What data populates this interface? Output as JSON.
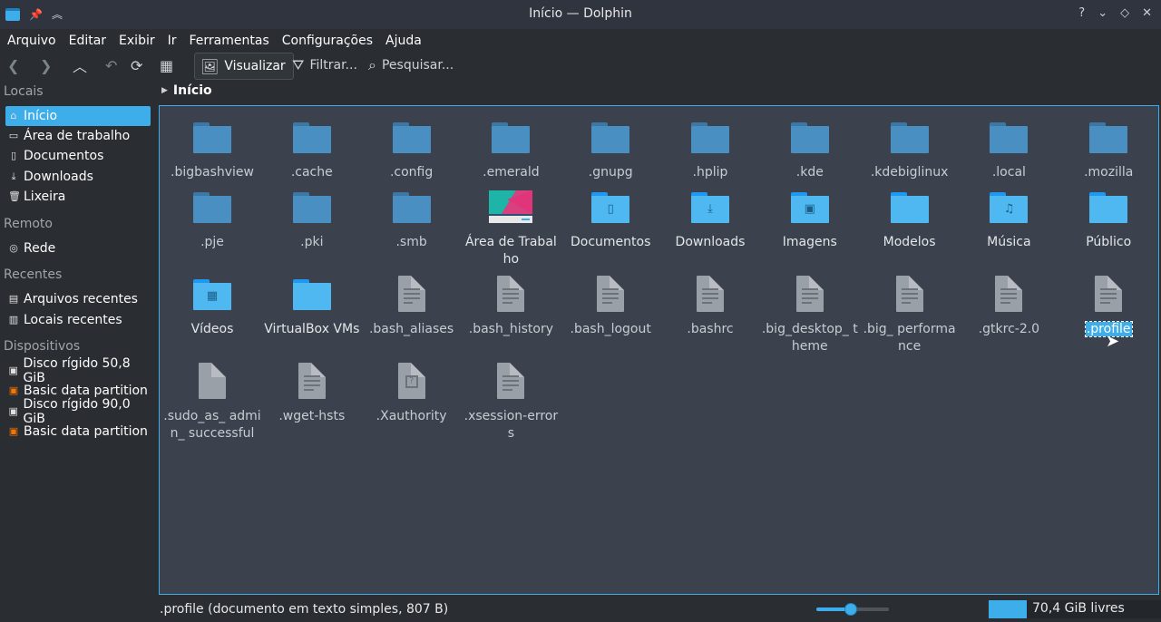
{
  "window": {
    "title": "Início — Dolphin",
    "controls": [
      "?",
      "⌄",
      "◇",
      "✕"
    ]
  },
  "menu": [
    "Arquivo",
    "Editar",
    "Exibir",
    "Ir",
    "Ferramentas",
    "Configurações",
    "Ajuda"
  ],
  "toolbar": {
    "view_label": "Visualizar",
    "filter_label": "Filtrar...",
    "search_label": "Pesquisar..."
  },
  "sidebar": {
    "places_title": "Locais",
    "places": [
      "Início",
      "Área de trabalho",
      "Documentos",
      "Downloads",
      "Lixeira"
    ],
    "remote_title": "Remoto",
    "remote": [
      "Rede"
    ],
    "recent_title": "Recentes",
    "recent": [
      "Arquivos recentes",
      "Locais recentes"
    ],
    "devices_title": "Dispositivos",
    "devices": [
      "Disco rígido 50,8 GiB",
      "Basic data partition",
      "Disco rígido 90,0 GiB",
      "Basic data partition"
    ]
  },
  "breadcrumb": "Início",
  "files": [
    {
      "label": ".bigbashview",
      "kind": "folder-dim"
    },
    {
      "label": ".cache",
      "kind": "folder-dim"
    },
    {
      "label": ".config",
      "kind": "folder-dim"
    },
    {
      "label": ".emerald",
      "kind": "folder-dim"
    },
    {
      "label": ".gnupg",
      "kind": "folder-dim"
    },
    {
      "label": ".hplip",
      "kind": "folder-dim"
    },
    {
      "label": ".kde",
      "kind": "folder-dim"
    },
    {
      "label": ".kdebiglinux",
      "kind": "folder-dim"
    },
    {
      "label": ".local",
      "kind": "folder-dim"
    },
    {
      "label": ".mozilla",
      "kind": "folder-dim"
    },
    {
      "label": ".pje",
      "kind": "folder-dim"
    },
    {
      "label": ".pki",
      "kind": "folder-dim"
    },
    {
      "label": ".smb",
      "kind": "folder-dim"
    },
    {
      "label": "Área de Trabalho",
      "kind": "image"
    },
    {
      "label": "Documentos",
      "kind": "folder-bright",
      "glyph": "▯"
    },
    {
      "label": "Downloads",
      "kind": "folder-bright",
      "glyph": "⤓"
    },
    {
      "label": "Imagens",
      "kind": "folder-bright",
      "glyph": "▣"
    },
    {
      "label": "Modelos",
      "kind": "folder-bright",
      "glyph": ""
    },
    {
      "label": "Música",
      "kind": "folder-bright",
      "glyph": "♫"
    },
    {
      "label": "Público",
      "kind": "folder-bright",
      "glyph": ""
    },
    {
      "label": "Vídeos",
      "kind": "folder-bright",
      "glyph": "▦"
    },
    {
      "label": "VirtualBox VMs",
      "kind": "folder-bright",
      "glyph": ""
    },
    {
      "label": ".bash_aliases",
      "kind": "doc"
    },
    {
      "label": ".bash_history",
      "kind": "doc"
    },
    {
      "label": ".bash_logout",
      "kind": "doc"
    },
    {
      "label": ".bashrc",
      "kind": "doc"
    },
    {
      "label": ".big_desktop_ theme",
      "kind": "doc"
    },
    {
      "label": ".big_ performance",
      "kind": "doc"
    },
    {
      "label": ".gtkrc-2.0",
      "kind": "doc"
    },
    {
      "label": ".profile",
      "kind": "doc",
      "selected": true
    },
    {
      "label": ".sudo_as_ admin_ successful",
      "kind": "blank"
    },
    {
      "label": ".wget-hsts",
      "kind": "doc"
    },
    {
      "label": ".Xauthority",
      "kind": "unknown"
    },
    {
      "label": ".xsession-errors",
      "kind": "doc"
    }
  ],
  "status": {
    "text": ".profile (documento em texto simples, 807 B)",
    "free_space": "70,4 GiB livres",
    "zoom_level": 0.48
  },
  "colors": {
    "accent": "#3daee9",
    "view_bg": "#3c424d",
    "window_bg": "#2a2e32"
  }
}
